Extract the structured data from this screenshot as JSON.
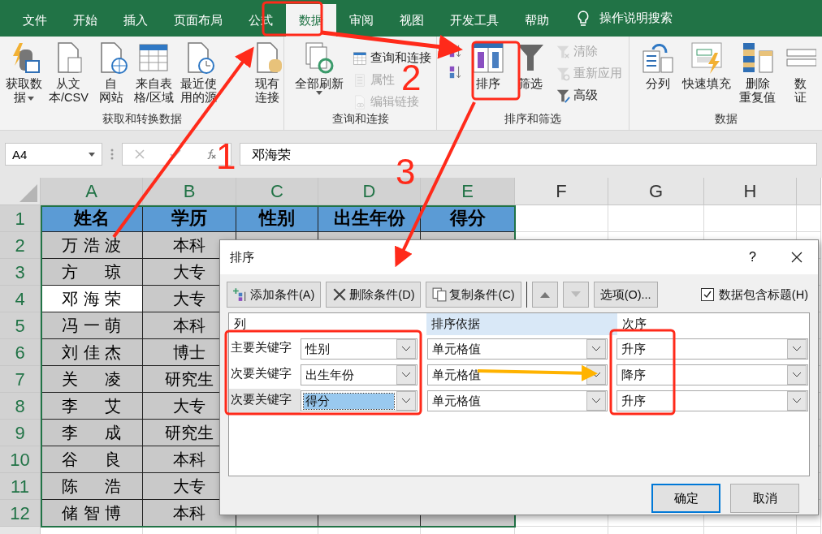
{
  "ribbon_tabs": [
    {
      "label": "文件",
      "selected": false
    },
    {
      "label": "开始",
      "selected": false
    },
    {
      "label": "插入",
      "selected": false
    },
    {
      "label": "页面布局",
      "selected": false
    },
    {
      "label": "公式",
      "selected": false
    },
    {
      "label": "数据",
      "selected": true
    },
    {
      "label": "审阅",
      "selected": false
    },
    {
      "label": "视图",
      "selected": false
    },
    {
      "label": "开发工具",
      "selected": false
    },
    {
      "label": "帮助",
      "selected": false
    }
  ],
  "tell_me": "操作说明搜索",
  "ribbon": [
    {
      "label": "获取和转换数据",
      "items": [
        {
          "kind": "large",
          "lines": [
            "获取数",
            "据"
          ],
          "dropdown": true
        },
        {
          "kind": "large",
          "lines": [
            "从文",
            "本/CSV"
          ]
        },
        {
          "kind": "large",
          "lines": [
            "自",
            "网站"
          ]
        },
        {
          "kind": "large",
          "lines": [
            "来自表",
            "格/区域"
          ]
        },
        {
          "kind": "large",
          "lines": [
            "最近使",
            "用的源"
          ]
        },
        {
          "kind": "large",
          "lines": [
            "现有",
            "连接"
          ]
        }
      ]
    },
    {
      "label": "查询和连接",
      "items": [
        {
          "kind": "large",
          "lines": [
            "全部刷新"
          ],
          "dropdown": true
        },
        {
          "kind": "stack",
          "items": [
            {
              "label": "查询和连接",
              "disabled": false
            },
            {
              "label": "属性",
              "disabled": true
            },
            {
              "label": "编辑链接",
              "disabled": true
            }
          ]
        }
      ]
    },
    {
      "label": "排序和筛选",
      "items": [
        {
          "kind": "stack",
          "items": [
            {
              "disabled": false
            },
            {
              "disabled": false
            }
          ]
        },
        {
          "kind": "large",
          "lines": [
            "排序"
          ]
        },
        {
          "kind": "large",
          "lines": [
            "筛选"
          ]
        },
        {
          "kind": "stack",
          "items": [
            {
              "label": "清除",
              "disabled": true
            },
            {
              "label": "重新应用",
              "disabled": true
            },
            {
              "label": "高级",
              "disabled": false
            }
          ]
        }
      ]
    },
    {
      "label": "数据",
      "items": [
        {
          "kind": "large",
          "lines": [
            "分列"
          ]
        },
        {
          "kind": "large",
          "lines": [
            "快速填充"
          ]
        },
        {
          "kind": "large",
          "lines": [
            "删除",
            "重复值"
          ]
        },
        {
          "kind": "large",
          "lines": [
            "数",
            "证"
          ]
        }
      ]
    }
  ],
  "name_box": "A4",
  "formula": "邓海荣",
  "columns": [
    "A",
    "B",
    "C",
    "D",
    "E",
    "F",
    "G",
    "H"
  ],
  "rows": [
    {
      "number": "1",
      "cells": [
        {
          "text": "姓名",
          "selected": false
        },
        {
          "text": "学历",
          "selected": false
        },
        {
          "text": "性别",
          "selected": false
        },
        {
          "text": "出生年份",
          "selected": false
        },
        {
          "text": "得分",
          "selected": false
        }
      ]
    },
    {
      "number": "2",
      "cells": [
        {
          "text": "万浩波",
          "selected": false
        },
        {
          "text": "本科",
          "selected": false
        }
      ]
    },
    {
      "number": "3",
      "cells": [
        {
          "text": "方 琼",
          "selected": false
        },
        {
          "text": "大专",
          "selected": false
        }
      ]
    },
    {
      "number": "4",
      "cells": [
        {
          "text": "邓海荣",
          "selected": true
        },
        {
          "text": "大专",
          "selected": false
        }
      ]
    },
    {
      "number": "5",
      "cells": [
        {
          "text": "冯一萌",
          "selected": false
        },
        {
          "text": "本科",
          "selected": false
        }
      ]
    },
    {
      "number": "6",
      "cells": [
        {
          "text": "刘佳杰",
          "selected": false
        },
        {
          "text": "博士",
          "selected": false
        }
      ]
    },
    {
      "number": "7",
      "cells": [
        {
          "text": "关 凌",
          "selected": false
        },
        {
          "text": "研究生",
          "selected": false
        }
      ]
    },
    {
      "number": "8",
      "cells": [
        {
          "text": "李 艾",
          "selected": false
        },
        {
          "text": "大专",
          "selected": false
        }
      ]
    },
    {
      "number": "9",
      "cells": [
        {
          "text": "李 成",
          "selected": false
        },
        {
          "text": "研究生",
          "selected": false
        }
      ]
    },
    {
      "number": "10",
      "cells": [
        {
          "text": "谷 良",
          "selected": false
        },
        {
          "text": "本科",
          "selected": false
        }
      ]
    },
    {
      "number": "11",
      "cells": [
        {
          "text": "陈 浩",
          "selected": false
        },
        {
          "text": "大专",
          "selected": false
        }
      ]
    },
    {
      "number": "12",
      "cells": [
        {
          "text": "储智博",
          "selected": false
        },
        {
          "text": "本科",
          "selected": false
        }
      ]
    }
  ],
  "dialog": {
    "title": "排序",
    "help": "?",
    "toolbar": [
      {
        "kind": "add",
        "label": "添加条件(A)"
      },
      {
        "kind": "delete",
        "label": "删除条件(D)"
      },
      {
        "kind": "copy",
        "label": "复制条件(C)"
      },
      {
        "kind": "up"
      },
      {
        "kind": "down"
      },
      {
        "kind": "text",
        "label": "选项(O)..."
      }
    ],
    "has_headers": {
      "label": "数据包含标题(H)",
      "checked": true
    },
    "headers": [
      "列",
      "排序依据",
      "次序"
    ],
    "conditions": [
      {
        "label": "主要关键字",
        "column": "性别",
        "basis": "单元格值",
        "order": "升序",
        "selected": false
      },
      {
        "label": "次要关键字",
        "column": "出生年份",
        "basis": "单元格值",
        "order": "降序",
        "selected": false
      },
      {
        "label": "次要关键字",
        "column": "得分",
        "basis": "单元格值",
        "order": "升序",
        "selected": true
      }
    ],
    "buttons": [
      {
        "label": "确定",
        "default": true
      },
      {
        "label": "取消",
        "default": false
      }
    ]
  },
  "annotations": {
    "steps": [
      "1",
      "2",
      "3"
    ]
  }
}
